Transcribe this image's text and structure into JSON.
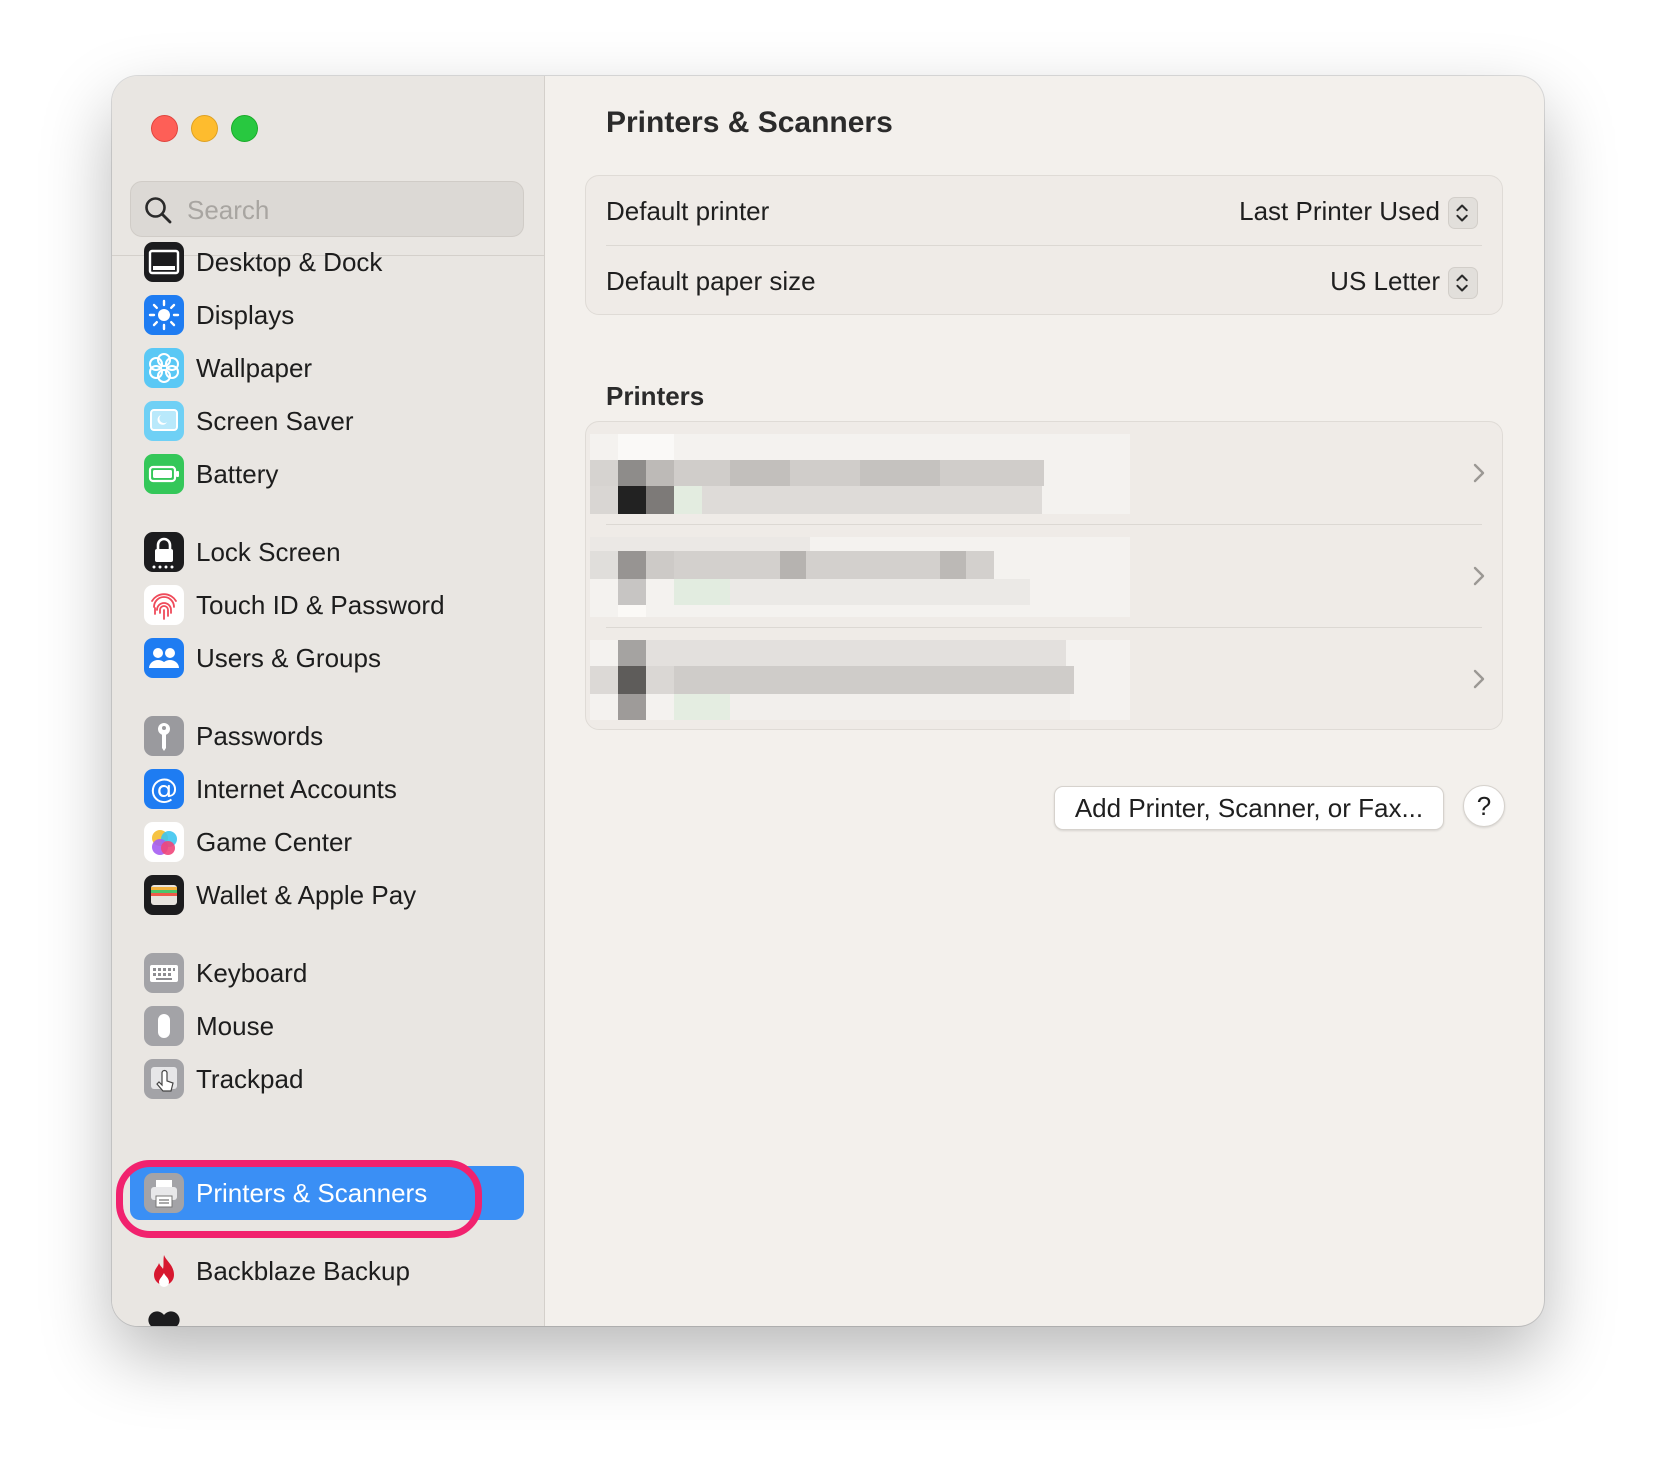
{
  "window": {
    "controls": [
      "close",
      "minimize",
      "zoom"
    ]
  },
  "search": {
    "placeholder": "Search"
  },
  "sidebar": {
    "items": [
      {
        "label": "Desktop & Dock",
        "icon": "dock-icon"
      },
      {
        "label": "Displays",
        "icon": "sun-icon"
      },
      {
        "label": "Wallpaper",
        "icon": "flower-icon"
      },
      {
        "label": "Screen Saver",
        "icon": "screen-saver-icon"
      },
      {
        "label": "Battery",
        "icon": "battery-icon"
      },
      {
        "label": "Lock Screen",
        "icon": "lock-icon"
      },
      {
        "label": "Touch ID & Password",
        "icon": "fingerprint-icon"
      },
      {
        "label": "Users & Groups",
        "icon": "users-icon"
      },
      {
        "label": "Passwords",
        "icon": "key-icon"
      },
      {
        "label": "Internet Accounts",
        "icon": "at-sign-icon"
      },
      {
        "label": "Game Center",
        "icon": "game-center-icon"
      },
      {
        "label": "Wallet & Apple Pay",
        "icon": "wallet-icon"
      },
      {
        "label": "Keyboard",
        "icon": "keyboard-icon"
      },
      {
        "label": "Mouse",
        "icon": "mouse-icon"
      },
      {
        "label": "Trackpad",
        "icon": "trackpad-icon"
      },
      {
        "label": "Printers & Scanners",
        "icon": "printer-icon",
        "selected": true
      },
      {
        "label": "Backblaze Backup",
        "icon": "flame-icon"
      }
    ]
  },
  "main": {
    "title": "Printers & Scanners",
    "settings": [
      {
        "label": "Default printer",
        "value": "Last Printer Used"
      },
      {
        "label": "Default paper size",
        "value": "US Letter"
      }
    ],
    "printers_title": "Printers",
    "printers_count": 3,
    "add_button": "Add Printer, Scanner, or Fax...",
    "help_button": "?"
  },
  "colors": {
    "accent": "#3a8ff5",
    "highlight_ring": "#f1226e",
    "window_bg": "#f3f0ec",
    "sidebar_bg": "#e9e6e2"
  }
}
